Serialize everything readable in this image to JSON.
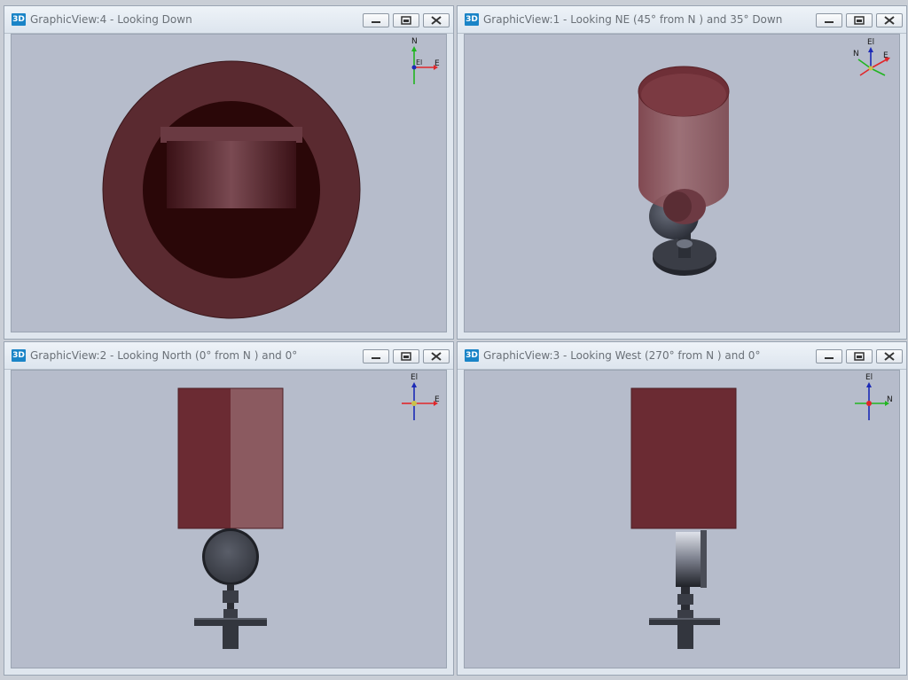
{
  "panes": {
    "top_left": {
      "title": "GraphicView:4 - Looking Down",
      "icon_label": "3D"
    },
    "top_right": {
      "title": "GraphicView:1 - Looking NE (45° from N ) and 35° Down",
      "icon_label": "3D"
    },
    "bottom_left": {
      "title": "GraphicView:2 - Looking North (0° from N ) and 0°",
      "icon_label": "3D"
    },
    "bottom_right": {
      "title": "GraphicView:3 - Looking West (270° from N ) and 0°",
      "icon_label": "3D"
    }
  },
  "triad": {
    "down": {
      "north": "N",
      "east": "E",
      "elev": "El"
    },
    "ne": {
      "north": "N",
      "east": "E",
      "elev": "El"
    },
    "north": {
      "east": "E",
      "elev": "El"
    },
    "west": {
      "north": "N",
      "elev": "El"
    }
  },
  "icons": {
    "minimize": "minimize-icon",
    "maximize": "maximize-icon",
    "close": "close-icon"
  },
  "colors": {
    "viewport_bg": "#b6bccb",
    "vessel": "#6b2b33",
    "vessel_light": "#8a575f",
    "gauge": "#3b3e47",
    "axis_x": "#e0262a",
    "axis_y": "#21b521",
    "axis_z": "#1c2ab6"
  }
}
